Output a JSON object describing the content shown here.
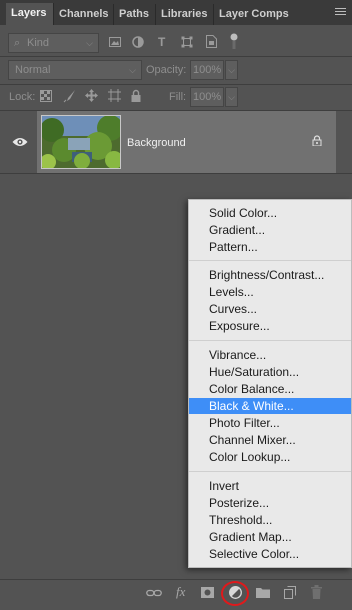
{
  "tabs": [
    {
      "label": "Layers",
      "active": true
    },
    {
      "label": "Channels",
      "active": false
    },
    {
      "label": "Paths",
      "active": false
    },
    {
      "label": "Libraries",
      "active": false
    },
    {
      "label": "Layer Comps",
      "active": false
    }
  ],
  "filter": {
    "kind_label": "Kind",
    "icon": "search-icon"
  },
  "blend": {
    "mode": "Normal",
    "opacity_label": "Opacity:",
    "opacity_value": "100%"
  },
  "lock_row": {
    "lock_label": "Lock:",
    "fill_label": "Fill:",
    "fill_value": "100%"
  },
  "layer": {
    "name": "Background"
  },
  "adjustment_menu": {
    "groups": [
      [
        "Solid Color...",
        "Gradient...",
        "Pattern..."
      ],
      [
        "Brightness/Contrast...",
        "Levels...",
        "Curves...",
        "Exposure..."
      ],
      [
        "Vibrance...",
        "Hue/Saturation...",
        "Color Balance...",
        "Black & White...",
        "Photo Filter...",
        "Channel Mixer...",
        "Color Lookup..."
      ],
      [
        "Invert",
        "Posterize...",
        "Threshold...",
        "Gradient Map...",
        "Selective Color..."
      ]
    ],
    "selected": "Black & White..."
  },
  "colors": {
    "panel_bg": "#535353",
    "selection": "#3e8ef7",
    "highlight_ring": "#e0191b"
  }
}
